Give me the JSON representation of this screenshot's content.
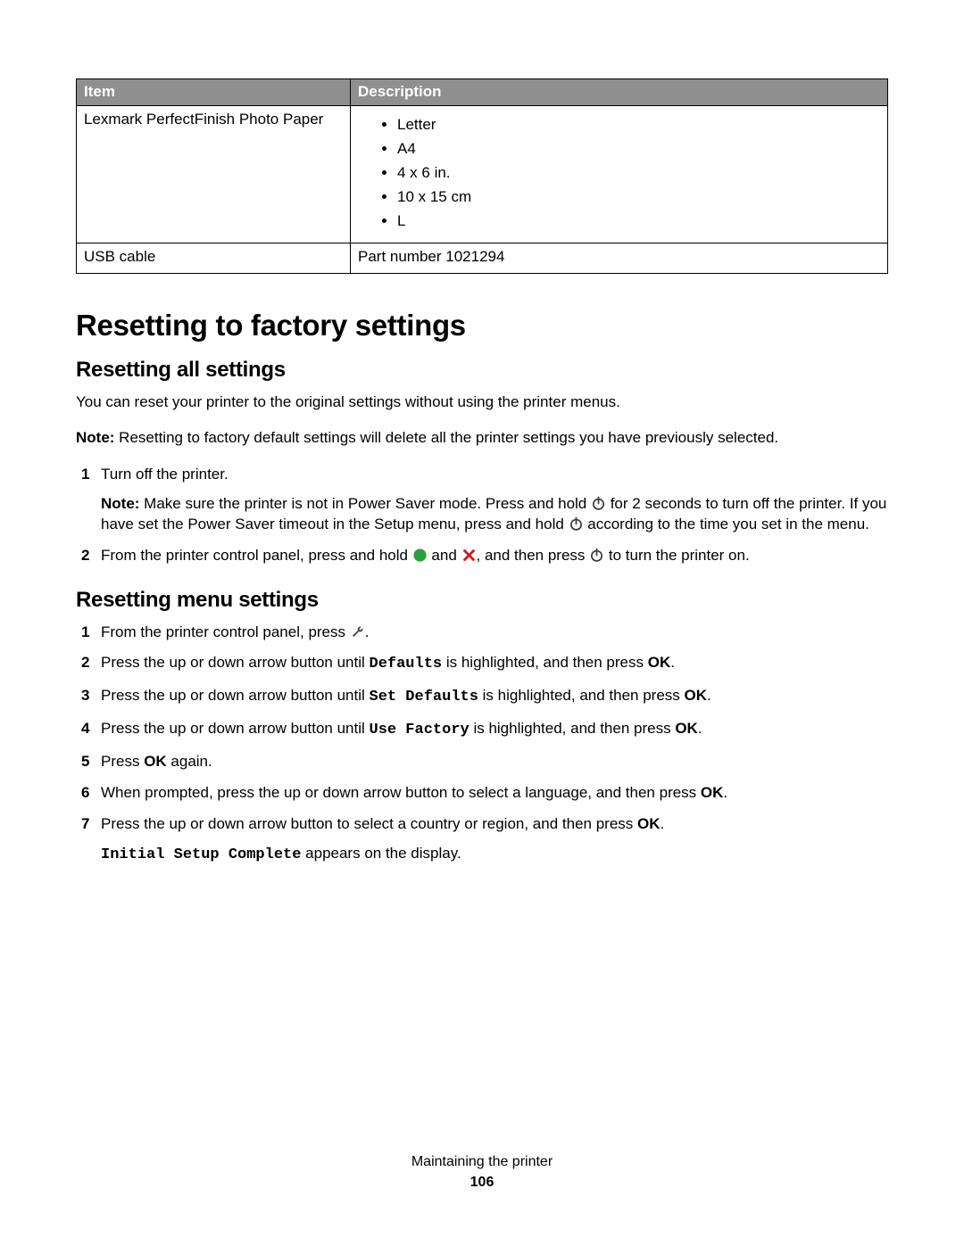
{
  "table": {
    "headers": {
      "item": "Item",
      "description": "Description"
    },
    "rows": {
      "photo_paper": {
        "item": "Lexmark PerfectFinish Photo Paper",
        "sizes": [
          "Letter",
          "A4",
          "4 x 6 in.",
          "10 x 15 cm",
          "L"
        ]
      },
      "usb": {
        "item": "USB cable",
        "description": "Part number 1021294"
      }
    }
  },
  "h1": "Resetting to factory settings",
  "section_all": {
    "heading": "Resetting all settings",
    "intro": "You can reset your printer to the original settings without using the printer menus.",
    "note_label": "Note:",
    "note_body": " Resetting to factory default settings will delete all the printer settings you have previously selected.",
    "step1": "Turn off the printer.",
    "step1_note_label": "Note:",
    "step1_note_a": " Make sure the printer is not in Power Saver mode. Press and hold ",
    "step1_note_b": " for 2 seconds to turn off the printer. If you have set the Power Saver timeout in the Setup menu, press and hold ",
    "step1_note_c": " according to the time you set in the menu.",
    "step2_a": "From the printer control panel, press and hold ",
    "step2_b": " and ",
    "step2_c": ", and then press ",
    "step2_d": " to turn the printer on."
  },
  "section_menu": {
    "heading": "Resetting menu settings",
    "step1_a": "From the printer control panel, press ",
    "step1_b": ".",
    "step2_a": "Press the up or down arrow button until ",
    "step2_code": "Defaults",
    "step2_b": " is highlighted, and then press ",
    "step2_ok": "OK",
    "step2_c": ".",
    "step3_a": "Press the up or down arrow button until ",
    "step3_code": "Set Defaults",
    "step3_b": " is highlighted, and then press ",
    "step3_ok": "OK",
    "step3_c": ".",
    "step4_a": "Press the up or down arrow button until ",
    "step4_code": "Use Factory",
    "step4_b": " is highlighted, and then press ",
    "step4_ok": "OK",
    "step4_c": ".",
    "step5_a": "Press ",
    "step5_ok": "OK",
    "step5_b": " again.",
    "step6_a": "When prompted, press the up or down arrow button to select a language, and then press ",
    "step6_ok": "OK",
    "step6_b": ".",
    "step7_a": "Press the up or down arrow button to select a country or region, and then press ",
    "step7_ok": "OK",
    "step7_b": ".",
    "step7_result_code": "Initial Setup Complete",
    "step7_result_b": " appears on the display."
  },
  "footer": {
    "section": "Maintaining the printer",
    "page": "106"
  }
}
